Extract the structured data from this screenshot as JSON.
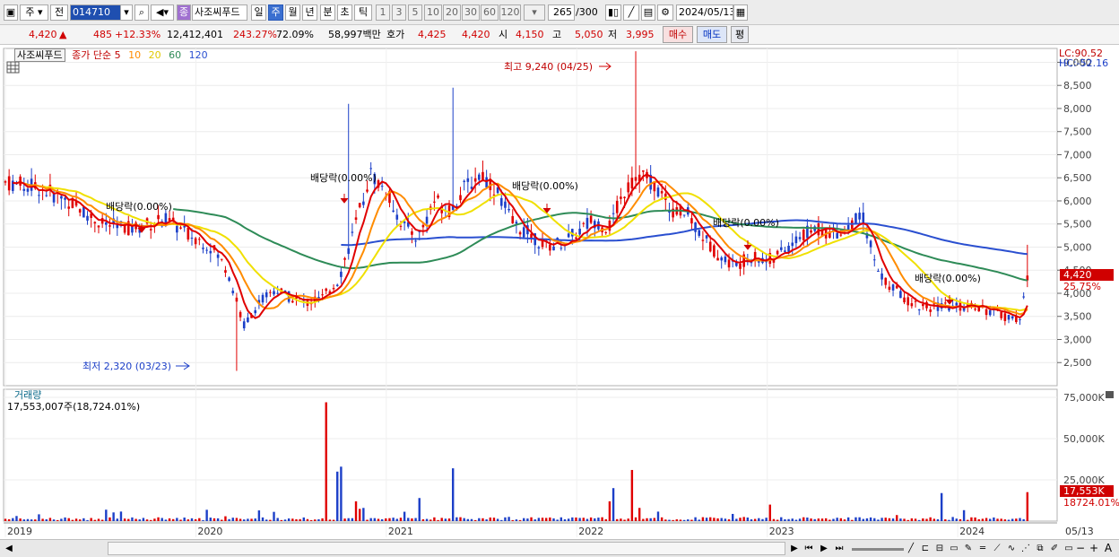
{
  "toolbar": {
    "type_select": "주",
    "prev_label": "전",
    "stock_code": "014710",
    "jong_label": "종",
    "stock_name": "사조씨푸드",
    "periods": [
      "일",
      "주",
      "월",
      "년",
      "분",
      "초",
      "틱"
    ],
    "active_period": "주",
    "intervals": [
      "1",
      "3",
      "5",
      "10",
      "20",
      "30",
      "60",
      "120"
    ],
    "view_count": "265",
    "view_total": "/300",
    "date": "2024/05/13"
  },
  "quote": {
    "price": "4,420",
    "arrow": "▲",
    "change": "485",
    "change_pct": "+12.33%",
    "volume": "12,412,401",
    "vol_ratio": "243.27%",
    "turnover": "72.09%",
    "amount": "58,997백만",
    "ask_label": "호가",
    "ask": "4,425",
    "bid": "4,420",
    "open_label": "시",
    "open": "4,150",
    "high_label": "고",
    "high": "5,050",
    "low_label": "저",
    "low": "3,995",
    "buy_label": "매수",
    "sell_label": "매도",
    "flat_label": "평"
  },
  "price_panel": {
    "name_tag": "사조씨푸드",
    "legend_prefix": "종가 단순",
    "ma_periods": [
      "5",
      "10",
      "20",
      "60",
      "120"
    ],
    "lc": "LC:90.52",
    "hc": "HC:-52.16",
    "current_price_tag": "4,420",
    "current_pct_tag": "25.75%",
    "y_ticks": [
      "9,000",
      "8,500",
      "8,000",
      "7,500",
      "7,000",
      "6,500",
      "6,000",
      "5,500",
      "5,000",
      "4,500",
      "4,000",
      "3,500",
      "3,000",
      "2,500"
    ],
    "max_label": "최고 9,240 (04/25)",
    "min_label": "최저 2,320 (03/23)",
    "dividend_labels": [
      "배당락(0.00%)",
      "배당락(0.00%)",
      "배당락(0.00%)",
      "배당락(0.00%)",
      "배당락(0.00%)"
    ]
  },
  "volume_panel": {
    "title": "거래량",
    "value_text": "17,553,007주(18,724.01%)",
    "y_ticks": [
      "75,000K",
      "50,000K",
      "25,000K"
    ],
    "current_tag": "17,553K",
    "current_pct": "18724.01%"
  },
  "x_axis": {
    "labels": [
      "2019",
      "2020",
      "2021",
      "2022",
      "2023",
      "2024",
      "05/13"
    ]
  },
  "colors": {
    "up": "#e00000",
    "down": "#1c3fc8",
    "ma5": "#e00000",
    "ma10": "#ff8c00",
    "ma20": "#f0e000",
    "ma60": "#2e8b57",
    "ma120": "#2a4fd0"
  },
  "chart_data": {
    "type": "candlestick",
    "title": "",
    "series": [
      {
        "name": "5",
        "x": [
          "2019-01",
          "2019-06",
          "2019-12",
          "2020-03",
          "2020-06",
          "2020-09",
          "2020-11",
          "2021-01",
          "2021-06",
          "2021-10",
          "2022-01",
          "2022-04",
          "2022-07",
          "2022-10",
          "2023-01",
          "2023-04",
          "2023-07",
          "2023-10",
          "2024-01",
          "2024-05"
        ],
        "values": [
          6350,
          5700,
          5300,
          3900,
          3950,
          4600,
          6700,
          5300,
          6400,
          5300,
          5350,
          6500,
          5600,
          4800,
          4700,
          5200,
          4200,
          3600,
          3650,
          3800
        ]
      },
      {
        "name": "120",
        "x": [
          "2020-12",
          "2021-06",
          "2022-01",
          "2022-07",
          "2023-01",
          "2023-06",
          "2024-01",
          "2024-05"
        ],
        "values": [
          5450,
          5300,
          5300,
          5400,
          5600,
          5550,
          5000,
          4850
        ]
      }
    ],
    "max": {
      "value": 9240,
      "date": "04/25"
    },
    "min": {
      "value": 2320,
      "date": "03/23"
    },
    "ylim": [
      2000,
      9300
    ],
    "volume_ylim": [
      0,
      75000
    ]
  }
}
